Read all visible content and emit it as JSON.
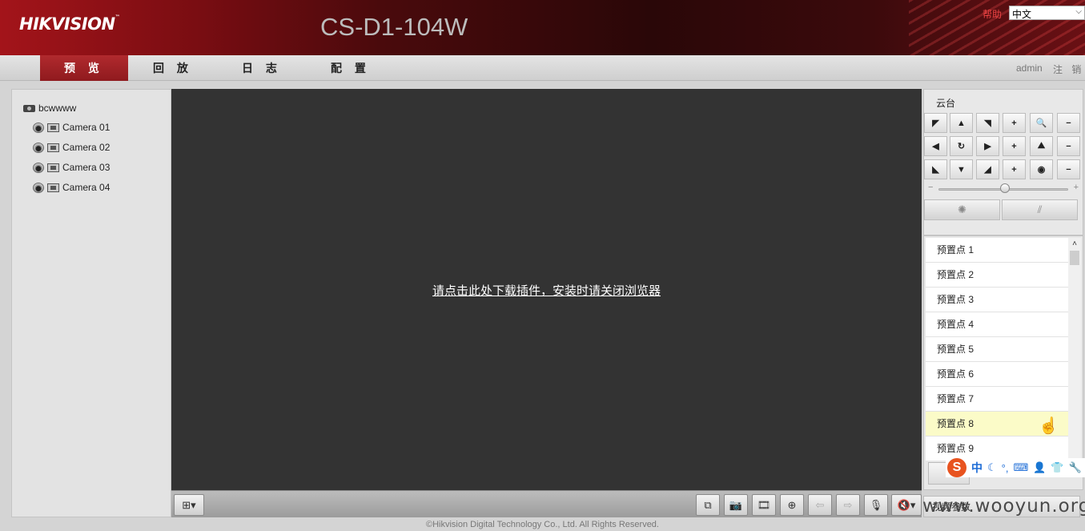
{
  "header": {
    "logo": "HIKVISION",
    "logo_tm": "™",
    "model": "CS-D1-104W",
    "help": "帮助",
    "language": "中文"
  },
  "nav": {
    "tabs": [
      "预 览",
      "回 放",
      "日 志",
      "配 置"
    ],
    "active_tab": "预 览",
    "user": "admin",
    "logout": "注 销"
  },
  "device_tree": {
    "root": "bcwwww",
    "cameras": [
      "Camera 01",
      "Camera 02",
      "Camera 03",
      "Camera 04"
    ]
  },
  "video": {
    "plugin_link": "请点击此处下载插件，安装时请关闭浏览器"
  },
  "toolbar": {
    "icons": [
      "layout-icon",
      "stop-all-icon",
      "capture-icon",
      "record-icon",
      "digital-zoom-icon",
      "prev-icon",
      "next-icon",
      "microphone-icon",
      "mute-icon"
    ]
  },
  "ptz": {
    "title": "云台",
    "zoom_in": "+",
    "zoom_out": "−",
    "slider_value": 0.5
  },
  "presets": {
    "items": [
      "预置点 1",
      "预置点 2",
      "预置点 3",
      "预置点 4",
      "预置点 5",
      "预置点 6",
      "预置点 7",
      "预置点 8",
      "预置点 9"
    ],
    "hovered_index": 7
  },
  "ime": {
    "logo": "S",
    "mode": "中"
  },
  "video_params": "视频参数",
  "watermark": "www.wooyun.org",
  "footer": {
    "copyright": "©Hikvision Digital Technology Co., Ltd. All Rights Reserved."
  },
  "colors": {
    "brand_red": "#a3141a",
    "video_bg": "#333333",
    "hover_row": "#fbfbc8"
  }
}
